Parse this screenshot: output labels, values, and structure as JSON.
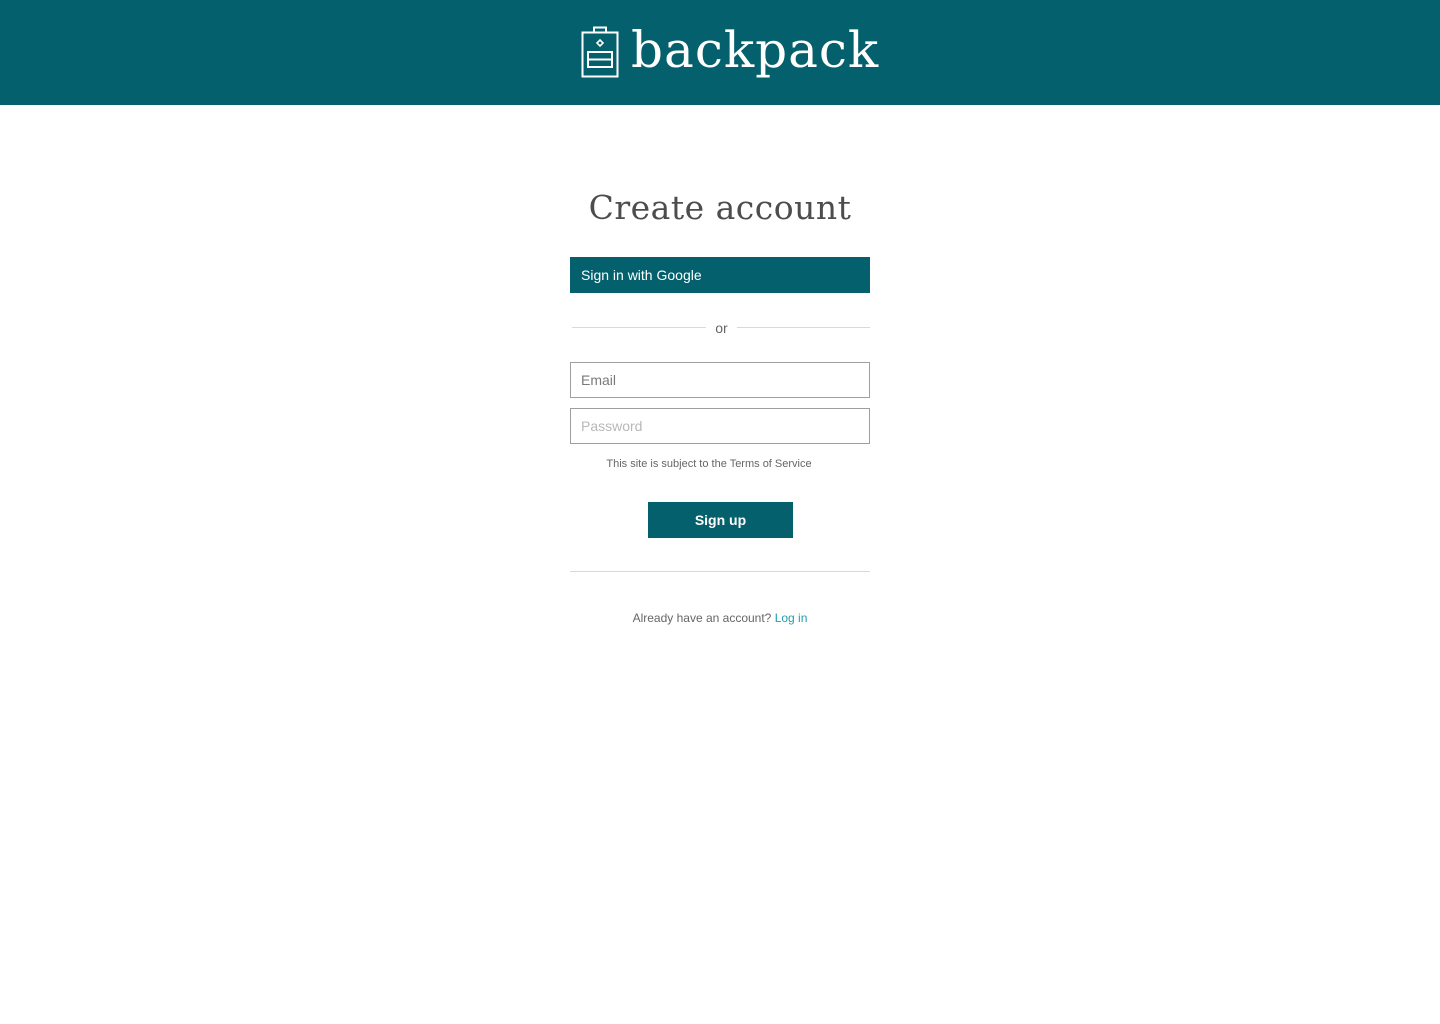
{
  "brand": {
    "name": "backpack",
    "icon": "backpack-icon"
  },
  "page": {
    "title": "Create account"
  },
  "google_button": {
    "label": "Sign in with Google"
  },
  "divider": {
    "text": "or"
  },
  "form": {
    "email_placeholder": "Email",
    "password_placeholder": "Password",
    "terms_text": "This site is subject to the Terms of Service",
    "signup_label": "Sign up"
  },
  "footer": {
    "prompt": "Already have an account?",
    "login_link": "Log in"
  },
  "colors": {
    "brand_teal": "#04606c",
    "link": "#19a0b4"
  }
}
